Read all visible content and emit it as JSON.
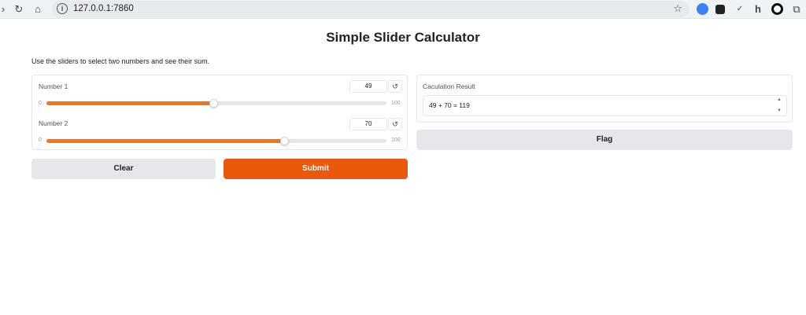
{
  "browser": {
    "url": "127.0.0.1:7860"
  },
  "app": {
    "title": "Simple Slider Calculator",
    "description": "Use the sliders to select two numbers and see their sum."
  },
  "sliders": [
    {
      "label": "Number 1",
      "value": "49",
      "min": "0",
      "max": "100",
      "fraction": 0.49
    },
    {
      "label": "Number 2",
      "value": "70",
      "min": "0",
      "max": "100",
      "fraction": 0.7
    }
  ],
  "buttons": {
    "clear": "Clear",
    "submit": "Submit",
    "flag": "Flag"
  },
  "output": {
    "label": "Caculation Result",
    "value": "49 + 70 = 119"
  },
  "colors": {
    "accent": "#f97316",
    "primary_button": "#ea580c",
    "secondary_button": "#e5e7eb"
  }
}
